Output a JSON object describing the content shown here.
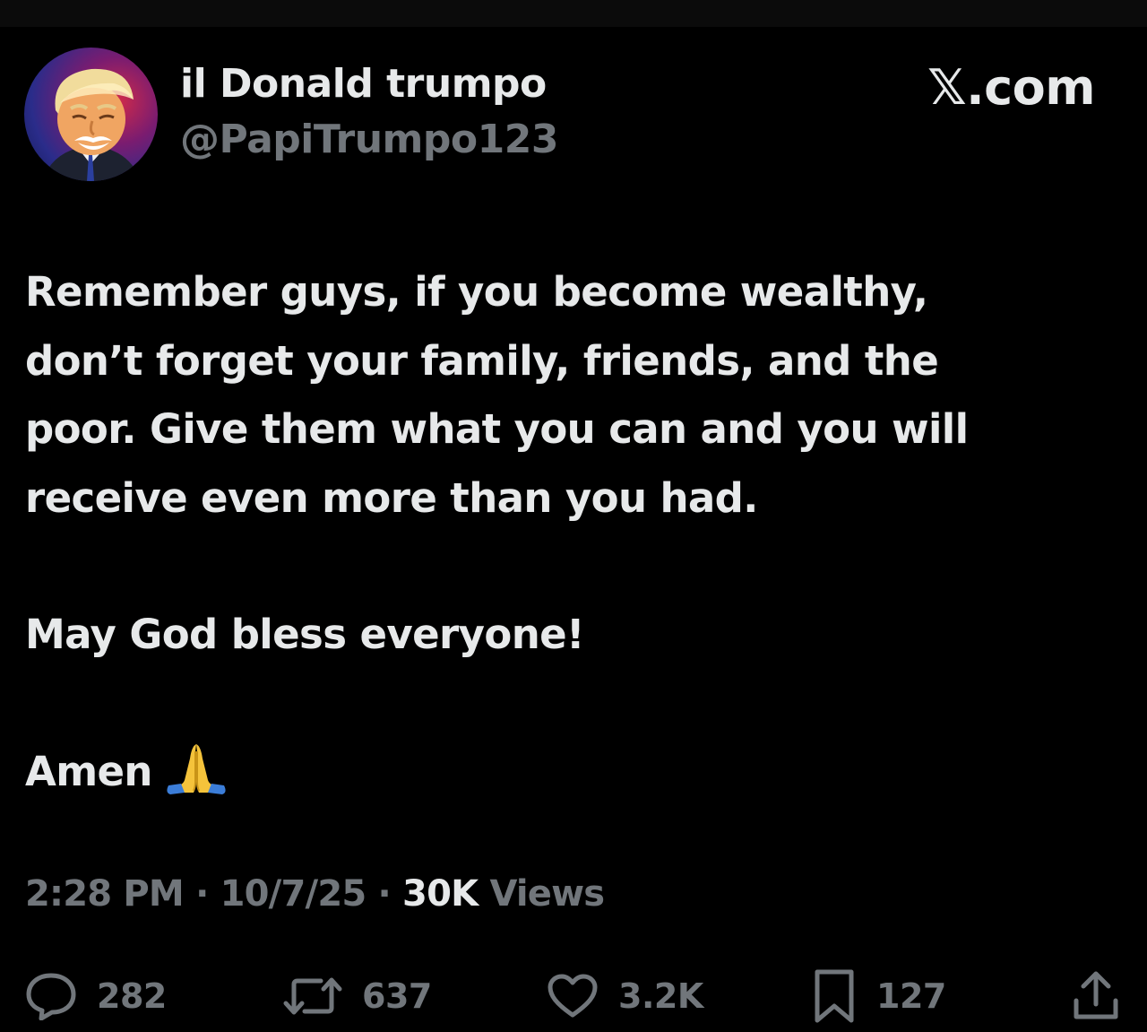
{
  "author": {
    "display_name": "il Donald trumpo",
    "handle": "@PapiTrumpo123",
    "avatar_icon": "profile-photo"
  },
  "brand": "𝕏.com",
  "tweet": {
    "paragraph_1": "Remember guys, if you become wealthy,\ndon’t forget your family, friends, and the\npoor. Give them what you can and you will\nreceive even more than you had.",
    "paragraph_2": "May God bless everyone!",
    "paragraph_3": "Amen",
    "emoji": "folded-hands-emoji"
  },
  "meta": {
    "time": "2:28 PM",
    "separator": " · ",
    "date": "10/7/25",
    "views_count": "30K",
    "views_label": " Views"
  },
  "actions": {
    "replies": "282",
    "reposts": "637",
    "likes": "3.2K",
    "bookmarks": "127"
  },
  "colors": {
    "background": "#000000",
    "text_primary": "#e7e9ea",
    "text_secondary": "#71767b"
  }
}
